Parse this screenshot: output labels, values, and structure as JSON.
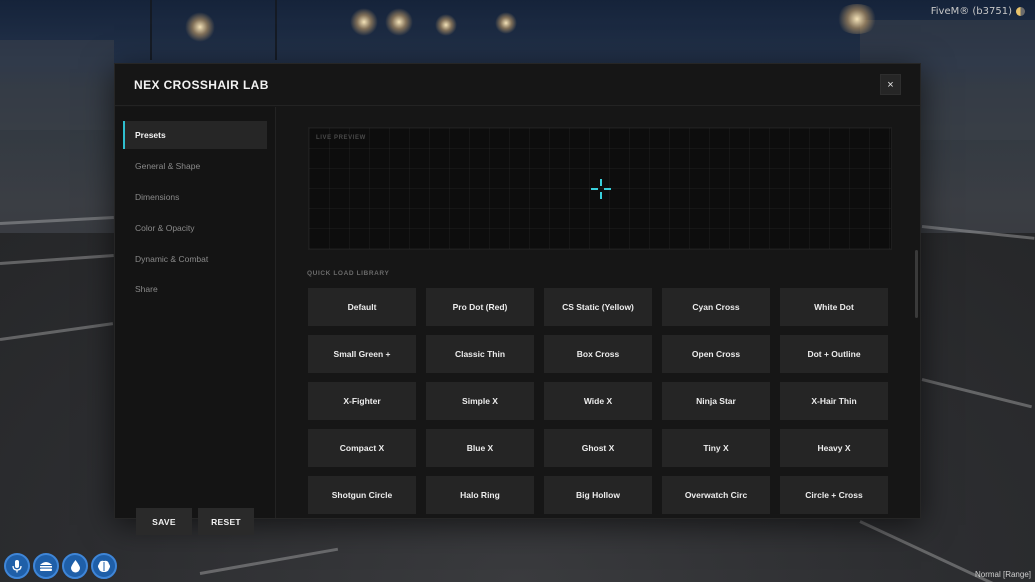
{
  "app": {
    "client_label": "FiveM® (b3751)",
    "status_text": "Normal [Range]"
  },
  "hud": {
    "buttons": [
      "microphone-icon",
      "burger-icon",
      "water-drop-icon",
      "brain-icon"
    ]
  },
  "modal": {
    "title": "NEX CROSSHAIR LAB",
    "close_label": "×",
    "accent_color": "#2fbfcf",
    "nav": [
      {
        "label": "Presets",
        "active": true
      },
      {
        "label": "General & Shape",
        "active": false
      },
      {
        "label": "Dimensions",
        "active": false
      },
      {
        "label": "Color & Opacity",
        "active": false
      },
      {
        "label": "Dynamic & Combat",
        "active": false
      },
      {
        "label": "Share",
        "active": false
      }
    ],
    "save_label": "SAVE",
    "reset_label": "RESET",
    "preview_label": "LIVE PREVIEW",
    "crosshair_color": "#39d0dc",
    "library_label": "QUICK LOAD LIBRARY",
    "presets": [
      "Default",
      "Pro Dot (Red)",
      "CS Static (Yellow)",
      "Cyan Cross",
      "White Dot",
      "Small Green +",
      "Classic Thin",
      "Box Cross",
      "Open Cross",
      "Dot + Outline",
      "X-Fighter",
      "Simple X",
      "Wide X",
      "Ninja Star",
      "X-Hair Thin",
      "Compact X",
      "Blue X",
      "Ghost X",
      "Tiny X",
      "Heavy X",
      "Shotgun Circle",
      "Halo Ring",
      "Big Hollow",
      "Overwatch Circ",
      "Circle + Cross"
    ]
  }
}
